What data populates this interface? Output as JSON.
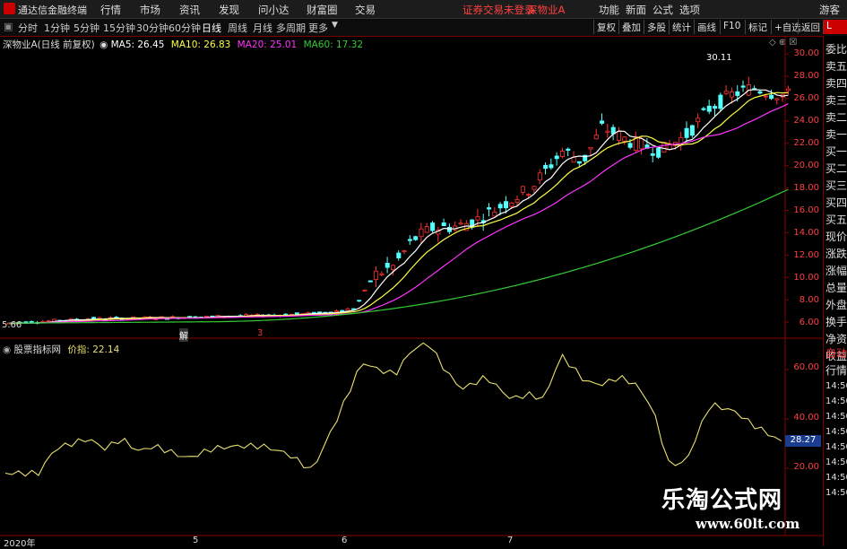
{
  "menubar": {
    "app_title": "通达信金融终端",
    "items": [
      "行情",
      "市场",
      "资讯",
      "发现",
      "问小达",
      "财富圈",
      "交易"
    ],
    "notice": "证券交易未登录",
    "stock": "深物业A",
    "right_items": [
      "功能",
      "新面",
      "公式",
      "选项"
    ],
    "user": "游客"
  },
  "toolbar": {
    "periods": [
      "分时",
      "1分钟",
      "5分钟",
      "15分钟",
      "30分钟",
      "60分钟",
      "日线",
      "周线",
      "月线",
      "多周期",
      "更多"
    ],
    "active": "日线",
    "right_buttons": [
      "复权",
      "叠加",
      "多股",
      "统计",
      "画线",
      "F10",
      "标记",
      "+自选",
      "返回"
    ]
  },
  "main_legend": {
    "title": "深物业A(日线 前复权)",
    "ma5": "MA5: 26.45",
    "ma10": "MA10: 26.83",
    "ma20": "MA20: 25.01",
    "ma60": "MA60: 17.32"
  },
  "sub_legend": {
    "title": "股票指标网",
    "value": "价指: 22.14"
  },
  "price_axis": [
    "30.00",
    "28.00",
    "26.00",
    "24.00",
    "22.00",
    "20.00",
    "18.00",
    "16.00",
    "14.00",
    "12.00",
    "10.00",
    "8.00",
    "6.00"
  ],
  "indicator_axis": [
    "60.00",
    "40.00",
    "20.00"
  ],
  "indicator_current": "28.27",
  "annotations": {
    "high": "30.11",
    "low": "5.66",
    "marker_a": "解",
    "marker_b": "3"
  },
  "date_labels": [
    "2020年",
    "5",
    "6",
    "7"
  ],
  "side_panel": {
    "labels": [
      "委比",
      "卖五",
      "卖四",
      "卖三",
      "卖二",
      "卖一",
      "买一",
      "买二",
      "买三",
      "买四",
      "买五",
      "现价",
      "涨跌",
      "涨幅",
      "总量",
      "外盘",
      "换手",
      "净资",
      "收益"
    ],
    "red_label": "L",
    "lower": [
      "自动",
      "行情",
      "14:50",
      "14:50",
      "14:50",
      "14:50",
      "14:50",
      "14:50",
      "14:50",
      "14:50"
    ]
  },
  "watermark": {
    "line1": "乐淘公式网",
    "line2": "www.60lt.com"
  },
  "colors": {
    "up": "#ff3232",
    "down": "#54ffff",
    "ma5": "#ffffff",
    "ma10": "#ffff44",
    "ma20": "#ff33ff",
    "ma60": "#33cc33",
    "indicator": "#e8e070",
    "accent": "#c00000"
  }
}
